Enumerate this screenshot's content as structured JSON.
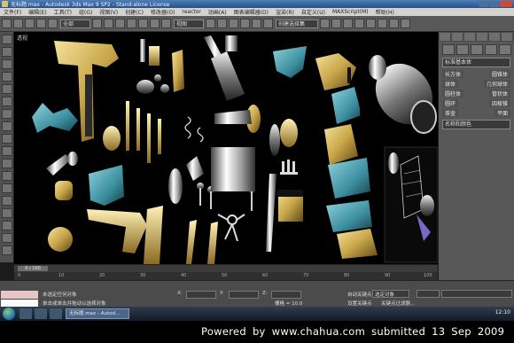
{
  "window": {
    "title": "无标题.max - Autodesk 3ds Max 9 SP2 - Stand-alone License",
    "controls": [
      "minimize",
      "maximize",
      "close"
    ]
  },
  "menu": [
    "文件(F)",
    "编辑(E)",
    "工具(T)",
    "组(G)",
    "视图(V)",
    "创建(C)",
    "修改器(O)",
    "reactor",
    "动画(A)",
    "图表编辑器(D)",
    "渲染(R)",
    "自定义(U)",
    "MAXScript(M)",
    "帮助(H)"
  ],
  "toolbar": {
    "selection_filter": "全部",
    "view_dropdown": "视图",
    "named_selection": "创建选择集"
  },
  "viewport": {
    "label": "透视",
    "inset_label": "渲染帧窗口"
  },
  "command_panel": {
    "modifier_dropdown": "标准基本体",
    "rows": [
      {
        "left": "长方体",
        "right": "圆锥体"
      },
      {
        "left": "球体",
        "right": "几何球体"
      },
      {
        "left": "圆柱体",
        "right": "管状体"
      },
      {
        "left": "圆环",
        "right": "四棱锥"
      },
      {
        "left": "茶壶",
        "right": "平面"
      }
    ],
    "section_title": "名称和颜色"
  },
  "timeline": {
    "slider_text": "0 / 100",
    "ruler_ticks": [
      "0",
      "10",
      "20",
      "30",
      "40",
      "50",
      "60",
      "70",
      "80",
      "90",
      "100"
    ]
  },
  "status": {
    "selected_text": "未选定任何对象",
    "prompt_text": "单击或单击并拖动以选择对象",
    "x_label": "X:",
    "y_label": "Y:",
    "z_label": "Z:",
    "grid_text": "栅格 = 10.0",
    "autokey_label": "自动关键点",
    "selected_dropdown": "选定对象",
    "setkey_label": "设置关键点",
    "keyfilter_label": "关键点过滤器..."
  },
  "taskbar": {
    "task_label": "无标题.max - Autod...",
    "clock": "12:10"
  },
  "watermark": {
    "text": "Powered by www.chahua.com submitted 13 Sep 2009"
  },
  "colors": {
    "gold": "#c9a64a",
    "teal": "#3d8fa0",
    "chrome": "#d8d8d8",
    "title_blue": "#2b5a95"
  }
}
